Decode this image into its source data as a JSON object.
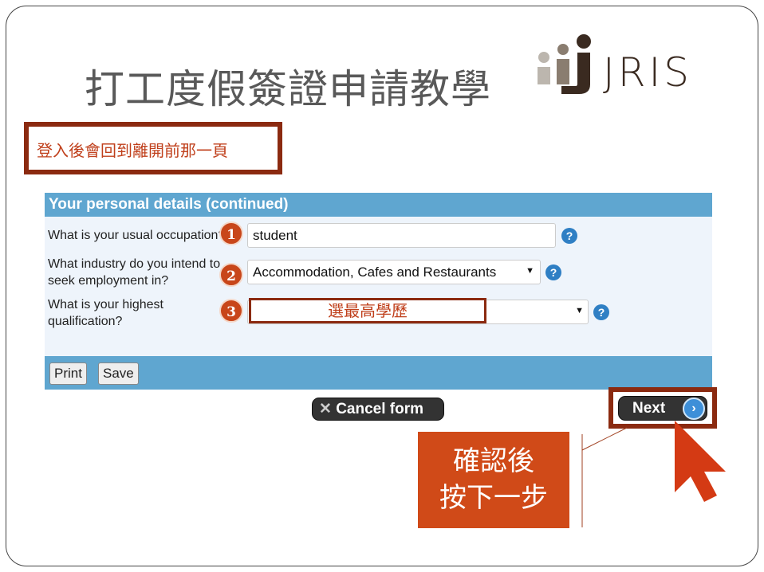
{
  "slide": {
    "title": "打工度假簽證申請教學",
    "logo_text": "JRIS",
    "note": "登入後會回到離開前那一頁",
    "callout_line1": "確認後",
    "callout_line2": "按下一步"
  },
  "form": {
    "header": "Your personal details (continued)",
    "q1": {
      "label": "What is your usual occupation?",
      "value": "student",
      "badge": "1"
    },
    "q2": {
      "label1": "What industry do you intend to",
      "label2": "seek employment in?",
      "value": "Accommodation, Cafes and Restaurants",
      "badge": "2"
    },
    "q3": {
      "label1": "What is your highest",
      "label2": "qualification?",
      "overlay": "選最高學歷",
      "badge": "3"
    },
    "print": "Print",
    "save": "Save",
    "cancel": "Cancel form",
    "next": "Next"
  },
  "colors": {
    "accent": "#5fa6d0",
    "annotation": "#d04a18",
    "border": "#8b2a10"
  }
}
